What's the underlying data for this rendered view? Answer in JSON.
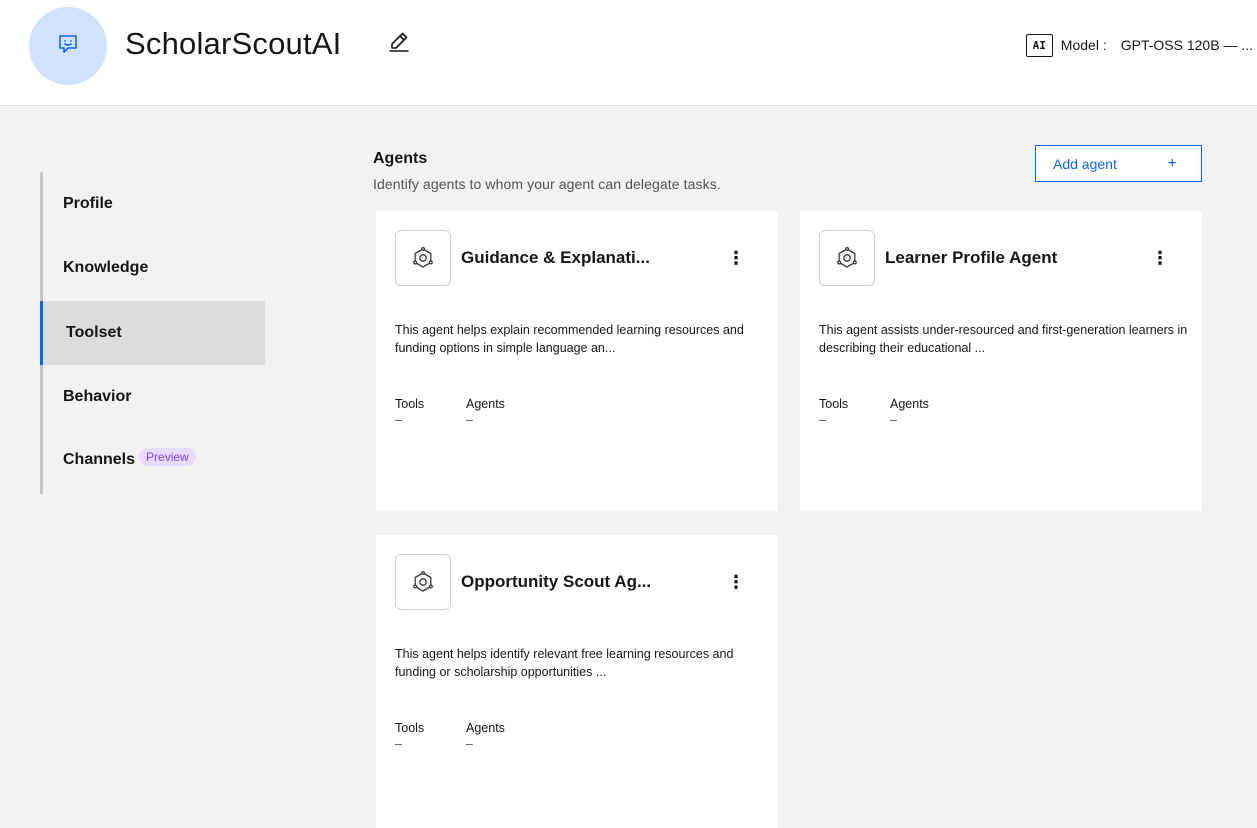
{
  "header": {
    "title": "ScholarScoutAI",
    "ai_badge": "AI",
    "model_label": "Model :",
    "model_value": "GPT-OSS 120B — ..."
  },
  "nav": {
    "items": [
      {
        "label": "Profile"
      },
      {
        "label": "Knowledge"
      },
      {
        "label": "Toolset"
      },
      {
        "label": "Behavior"
      },
      {
        "label": "Channels",
        "tag": "Preview"
      }
    ],
    "active": "Toolset"
  },
  "agents_section": {
    "title": "Agents",
    "description": "Identify agents to whom your agent can delegate tasks.",
    "add_button": "Add agent",
    "add_icon": "+"
  },
  "agents": [
    {
      "name": "Guidance & Explanati...",
      "description": "This agent helps explain recommended learning resources and funding options in simple language an...",
      "tools_label": "Tools",
      "tools_value": "–",
      "agents_label": "Agents",
      "agents_value": "–",
      "menu": "⋮"
    },
    {
      "name": "Learner Profile Agent",
      "description": "This agent assists under-resourced and first-generation learners in describing their educational ...",
      "tools_label": "Tools",
      "tools_value": "–",
      "agents_label": "Agents",
      "agents_value": "–",
      "menu": "⋮"
    },
    {
      "name": "Opportunity Scout Ag...",
      "description": "This agent helps identify relevant free learning resources and funding or scholarship opportunities ...",
      "tools_label": "Tools",
      "tools_value": "–",
      "agents_label": "Agents",
      "agents_value": "–",
      "menu": "⋮"
    }
  ],
  "colors": {
    "accent": "#0f62fe",
    "avatar_bg": "#d0e2ff",
    "preview_tag_bg": "#e8daff",
    "preview_tag_text": "#8a3ffc",
    "page_bg": "#f2f2f2"
  },
  "icons": {
    "avatar": "chat-bot-icon",
    "edit": "pencil-icon",
    "agent": "agent-hexagon-icon",
    "card_menu": "overflow-menu-icon",
    "add": "plus-icon"
  }
}
